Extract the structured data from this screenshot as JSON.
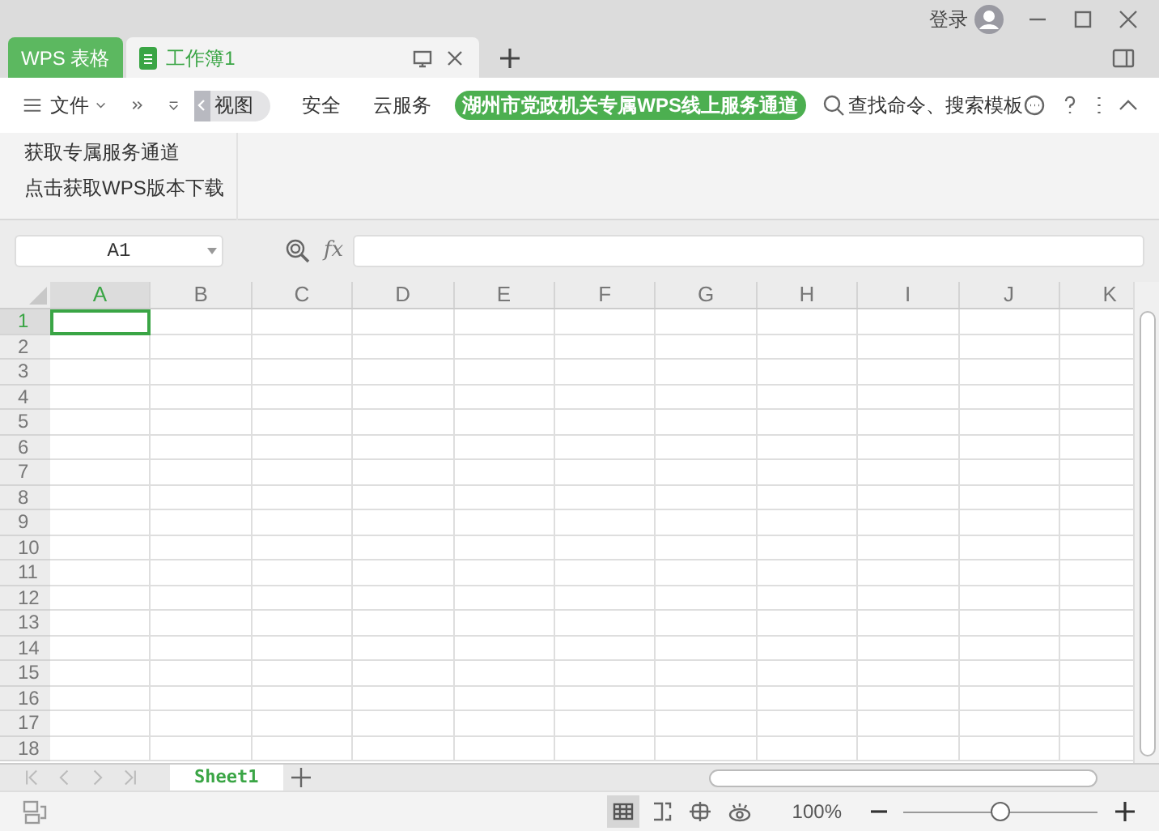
{
  "app_tab": "WPS 表格",
  "doc_tab": {
    "title": "工作簿1"
  },
  "account": {
    "login": "登录"
  },
  "ribbon": {
    "menu": "文件",
    "tabs": [
      {
        "label": "视图",
        "selected": true
      },
      {
        "label": "安全",
        "selected": false
      },
      {
        "label": "云服务",
        "selected": false
      }
    ],
    "promo": "湖州市党政机关专属WPS线上服务通道",
    "search": "查找命令、搜索模板",
    "links": [
      "获取专属服务通道",
      "点击获取WPS版本下载"
    ]
  },
  "formula_bar": {
    "name_box": "A1",
    "fx": "fx"
  },
  "columns": [
    {
      "label": "A",
      "selected": true
    },
    {
      "label": "B",
      "selected": false
    },
    {
      "label": "C",
      "selected": false
    },
    {
      "label": "D",
      "selected": false
    },
    {
      "label": "E",
      "selected": false
    },
    {
      "label": "F",
      "selected": false
    },
    {
      "label": "G",
      "selected": false
    },
    {
      "label": "H",
      "selected": false
    },
    {
      "label": "I",
      "selected": false
    },
    {
      "label": "J",
      "selected": false
    },
    {
      "label": "K",
      "selected": false
    }
  ],
  "rows": [
    {
      "label": "1",
      "selected": true
    },
    {
      "label": "2",
      "selected": false
    },
    {
      "label": "3",
      "selected": false
    },
    {
      "label": "4",
      "selected": false
    },
    {
      "label": "5",
      "selected": false
    },
    {
      "label": "6",
      "selected": false
    },
    {
      "label": "7",
      "selected": false
    },
    {
      "label": "8",
      "selected": false
    },
    {
      "label": "9",
      "selected": false
    },
    {
      "label": "10",
      "selected": false
    },
    {
      "label": "11",
      "selected": false
    },
    {
      "label": "12",
      "selected": false
    },
    {
      "label": "13",
      "selected": false
    },
    {
      "label": "14",
      "selected": false
    },
    {
      "label": "15",
      "selected": false
    },
    {
      "label": "16",
      "selected": false
    },
    {
      "label": "17",
      "selected": false
    },
    {
      "label": "18",
      "selected": false
    }
  ],
  "sheets": [
    {
      "label": "Sheet1",
      "selected": true
    }
  ],
  "status": {
    "zoom": "100%",
    "zoom_slider": {
      "level": 0.5
    }
  }
}
